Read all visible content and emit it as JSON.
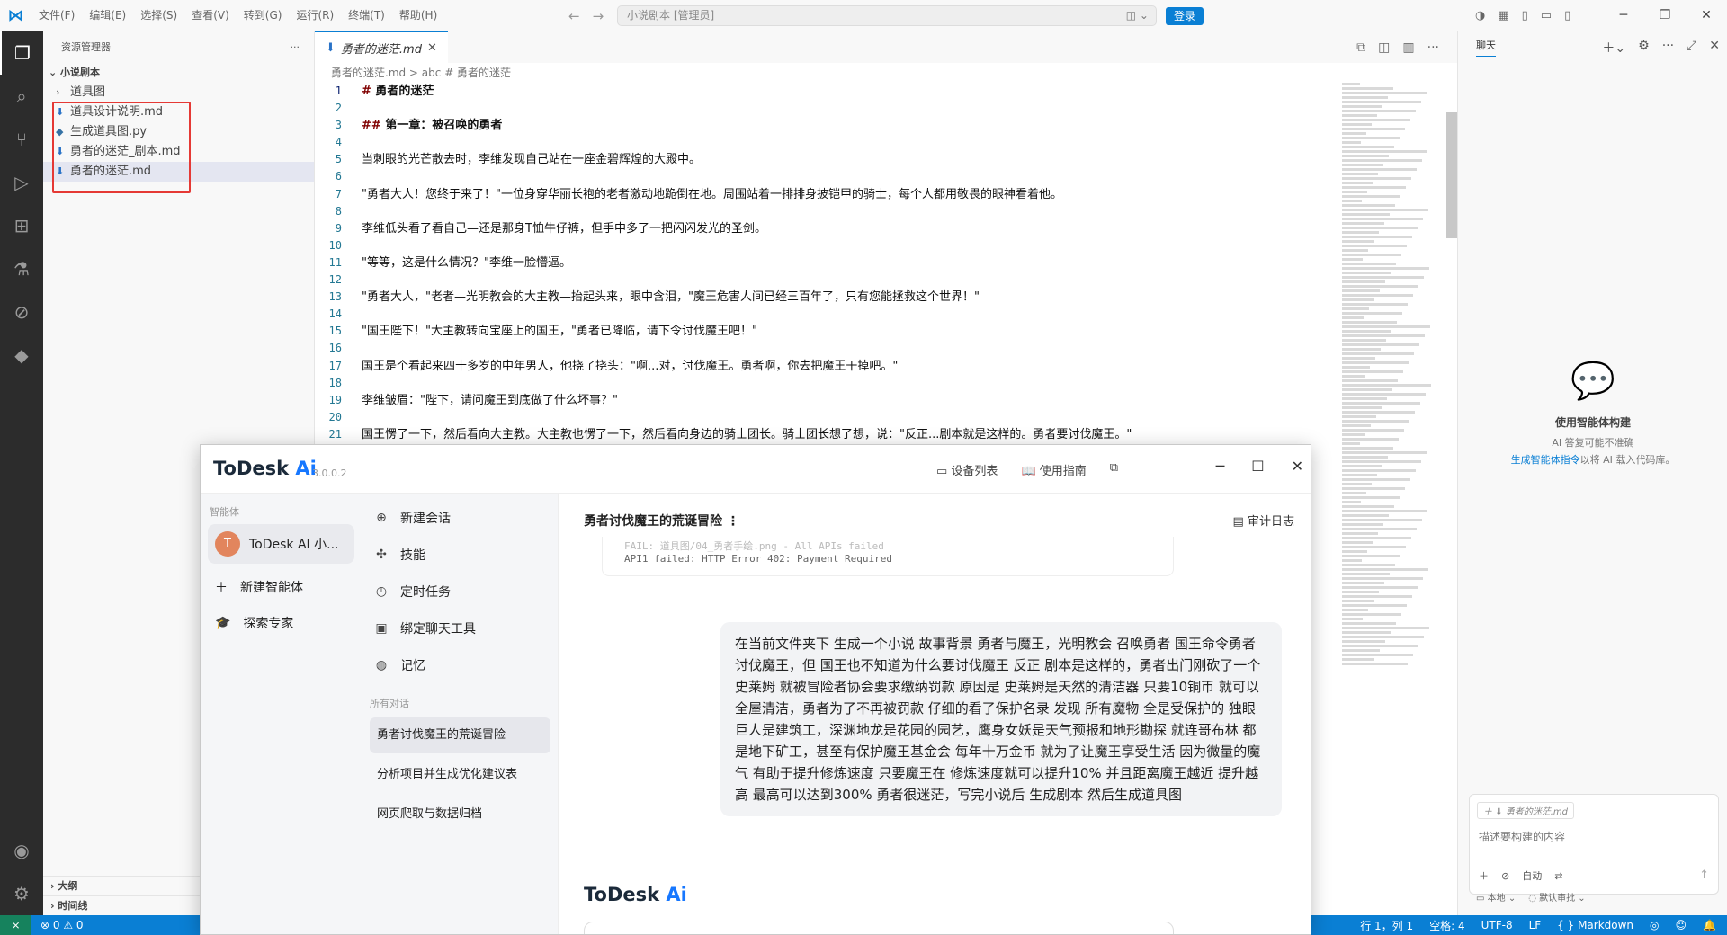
{
  "titlebar": {
    "menus": [
      "文件(F)",
      "编辑(E)",
      "选择(S)",
      "查看(V)",
      "转到(G)",
      "运行(R)",
      "终端(T)",
      "帮助(H)"
    ],
    "command_center": "小说剧本 [管理员]",
    "login": "登录"
  },
  "sidebar": {
    "title": "资源管理器",
    "root": "小说剧本",
    "items": [
      {
        "label": "道具图",
        "type": "folder"
      },
      {
        "label": "道具设计说明.md",
        "type": "md"
      },
      {
        "label": "生成道具图.py",
        "type": "py"
      },
      {
        "label": "勇者的迷茫_剧本.md",
        "type": "md"
      },
      {
        "label": "勇者的迷茫.md",
        "type": "md"
      }
    ],
    "bottom": [
      "大纲",
      "时间线"
    ]
  },
  "editor": {
    "tab": "勇者的迷茫.md",
    "breadcrumb": "勇者的迷茫.md > abc # 勇者的迷茫",
    "lines": [
      {
        "n": "1",
        "hash": "#",
        "text": " 勇者的迷茫",
        "style": "h1"
      },
      {
        "n": "2",
        "hash": "",
        "text": "",
        "style": ""
      },
      {
        "n": "3",
        "hash": "##",
        "text": " 第一章：被召唤的勇者",
        "style": "h2"
      },
      {
        "n": "4",
        "hash": "",
        "text": "",
        "style": ""
      },
      {
        "n": "5",
        "hash": "",
        "text": "当刺眼的光芒散去时，李维发现自己站在一座金碧辉煌的大殿中。",
        "style": ""
      },
      {
        "n": "6",
        "hash": "",
        "text": "",
        "style": ""
      },
      {
        "n": "7",
        "hash": "",
        "text": "\"勇者大人！您终于来了！\"一位身穿华丽长袍的老者激动地跪倒在地。周围站着一排排身披铠甲的骑士，每个人都用敬畏的眼神看着他。",
        "style": ""
      },
      {
        "n": "8",
        "hash": "",
        "text": "",
        "style": ""
      },
      {
        "n": "9",
        "hash": "",
        "text": "李维低头看了看自己—还是那身T恤牛仔裤，但手中多了一把闪闪发光的圣剑。",
        "style": ""
      },
      {
        "n": "10",
        "hash": "",
        "text": "",
        "style": ""
      },
      {
        "n": "11",
        "hash": "",
        "text": "\"等等，这是什么情况？\"李维一脸懵逼。",
        "style": ""
      },
      {
        "n": "12",
        "hash": "",
        "text": "",
        "style": ""
      },
      {
        "n": "13",
        "hash": "",
        "text": "\"勇者大人，\"老者—光明教会的大主教—抬起头来，眼中含泪，\"魔王危害人间已经三百年了，只有您能拯救这个世界！\"",
        "style": ""
      },
      {
        "n": "14",
        "hash": "",
        "text": "",
        "style": ""
      },
      {
        "n": "15",
        "hash": "",
        "text": "\"国王陛下！\"大主教转向宝座上的国王，\"勇者已降临，请下令讨伐魔王吧！\"",
        "style": ""
      },
      {
        "n": "16",
        "hash": "",
        "text": "",
        "style": ""
      },
      {
        "n": "17",
        "hash": "",
        "text": "国王是个看起来四十多岁的中年男人，他挠了挠头：\"啊...对，讨伐魔王。勇者啊，你去把魔王干掉吧。\"",
        "style": ""
      },
      {
        "n": "18",
        "hash": "",
        "text": "",
        "style": ""
      },
      {
        "n": "19",
        "hash": "",
        "text": "李维皱眉：\"陛下，请问魔王到底做了什么坏事？\"",
        "style": ""
      },
      {
        "n": "20",
        "hash": "",
        "text": "",
        "style": ""
      },
      {
        "n": "21",
        "hash": "",
        "text": "国王愣了一下，然后看向大主教。大主教也愣了一下，然后看向身边的骑士团长。骑士团长想了想，说：\"反正...剧本就是这样的。勇者要讨伐魔王。\"",
        "style": ""
      }
    ]
  },
  "chat": {
    "title": "聊天",
    "empty_title": "使用智能体构建",
    "empty_note": "AI 答复可能不准确",
    "empty_link": "生成智能体指令",
    "empty_tail": "以将 AI 载入代码库。",
    "context_file": "勇者的迷茫.md",
    "placeholder": "描述要构建的内容",
    "mode": "自动",
    "foot_local": "本地",
    "foot_approval": "默认审批"
  },
  "statusbar": {
    "problems": "⊗ 0 ⚠ 0",
    "position": "行 1，列 1",
    "spaces": "空格: 4",
    "encoding": "UTF-8",
    "eol": "LF",
    "language": "{ } Markdown"
  },
  "todesk": {
    "logo": "ToDesk",
    "logo_ai": "Ai",
    "version": "3.0.0.2",
    "device_list": "设备列表",
    "guide": "使用指南",
    "section_agents": "智能体",
    "agent_name": "ToDesk AI 小...",
    "agent_initial": "T",
    "new_agent": "新建智能体",
    "explore": "探索专家",
    "menu": [
      "新建会话",
      "技能",
      "定时任务",
      "绑定聊天工具",
      "记忆"
    ],
    "all_conversations": "所有对话",
    "conversations": [
      "勇者讨伐魔王的荒诞冒险",
      "分析项目并生成优化建议表",
      "网页爬取与数据归档"
    ],
    "conv_title": "勇者讨伐魔王的荒诞冒险",
    "audit": "审计日志",
    "error_faded": "FAIL: 道具图/04_勇者手绘.png - All APIs failed",
    "error_line": "API1 failed: HTTP Error 402: Payment Required",
    "user_message": "在当前文件夹下 生成一个小说 故事背景 勇者与魔王，光明教会 召唤勇者 国王命令勇者讨伐魔王，但 国王也不知道为什么要讨伐魔王 反正 剧本是这样的，勇者出门刚砍了一个史莱姆 就被冒险者协会要求缴纳罚款 原因是 史莱姆是天然的清洁器 只要10铜币 就可以全屋清洁，勇者为了不再被罚款 仔细的看了保护名录 发现 所有魔物 全是受保护的 独眼巨人是建筑工，深渊地龙是花园的园艺，鹰身女妖是天气预报和地形勘探 就连哥布林 都是地下矿工，甚至有保护魔王基金会 每年十万金币 就为了让魔王享受生活 因为微量的魔气 有助于提升修炼速度 只要魔王在 修炼速度就可以提升10% 并且距离魔王越近 提升越高 最高可以达到300% 勇者很迷茫，写完小说后 生成剧本 然后生成道具图"
  }
}
